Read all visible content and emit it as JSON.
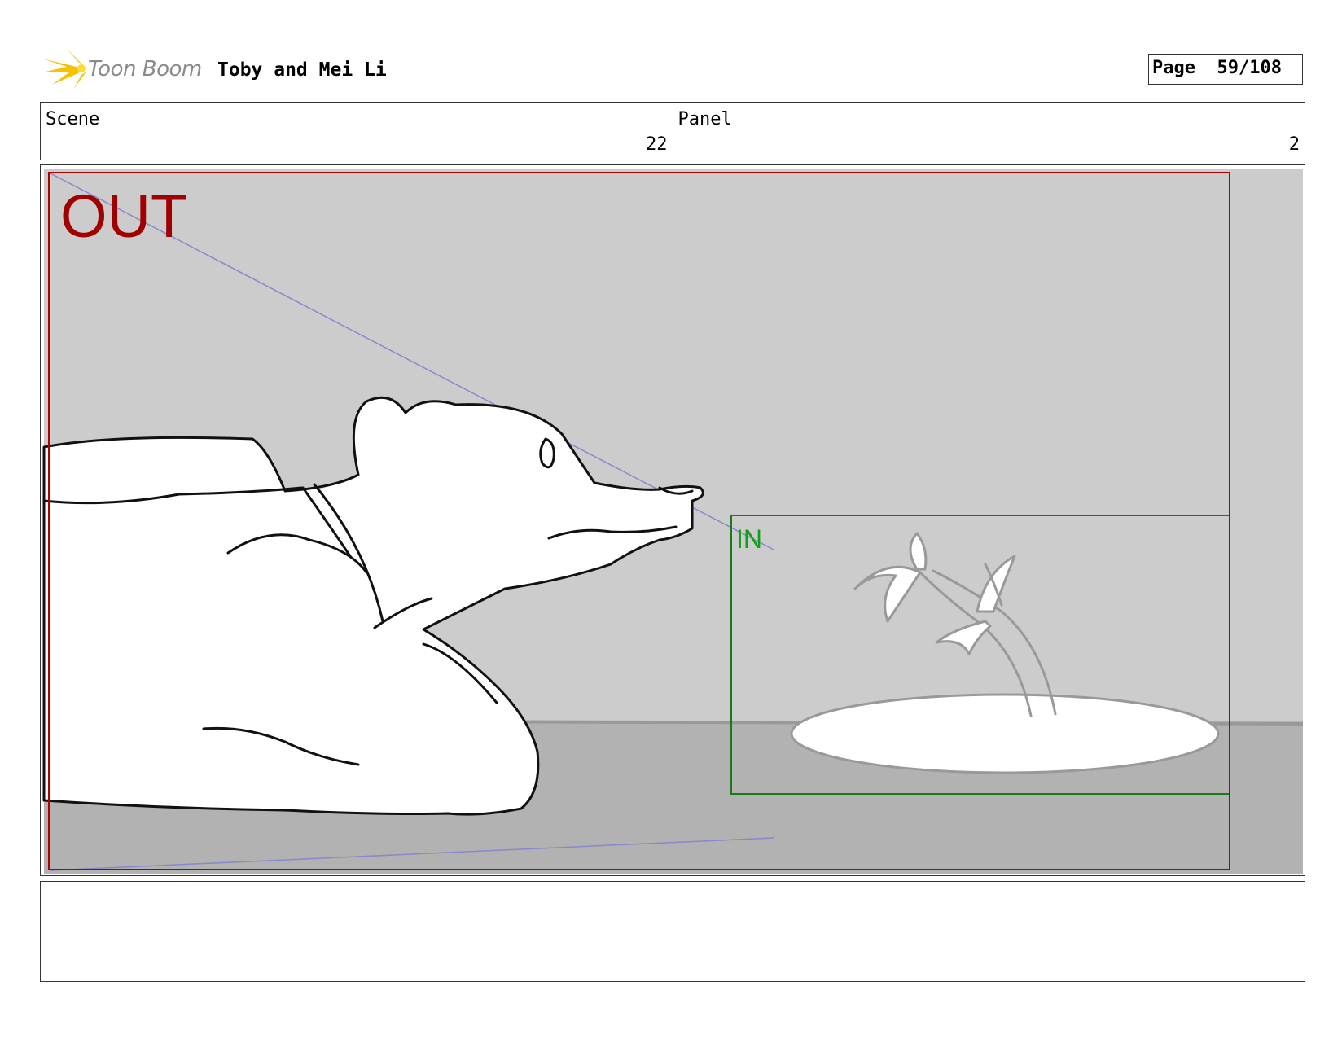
{
  "header": {
    "brand": "Toon Boom",
    "project_title": "Toby and Mei Li",
    "page_label": "Page",
    "page_value": "59/108"
  },
  "info": {
    "scene_label": "Scene",
    "scene_value": "22",
    "panel_label": "Panel",
    "panel_value": "2"
  },
  "panel": {
    "out_label": "OUT",
    "in_label": "IN",
    "colors": {
      "out_frame": "#b00000",
      "in_frame": "#1a7a1a",
      "in_text": "#10a010",
      "guide_lines": "#8888cc",
      "wall": "#cccccc",
      "floor": "#b2b2b2"
    }
  },
  "notes": {
    "text": ""
  }
}
